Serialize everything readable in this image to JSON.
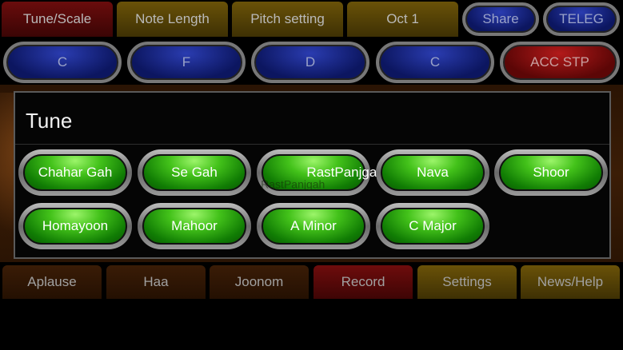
{
  "top_tabs": {
    "tune_scale": "Tune/Scale",
    "note_length": "Note Length",
    "pitch_setting": "Pitch setting",
    "octave": "Oct 1",
    "share": "Share",
    "teleg": "TELEG"
  },
  "key_buttons": [
    "C",
    "F",
    "D",
    "C"
  ],
  "acc_stop": "ACC STP",
  "dialog": {
    "title": "Tune",
    "options": [
      "Chahar Gah",
      "Se Gah",
      "RastPanjgah",
      "Nava",
      "Shoor",
      "Homayoon",
      "Mahoor",
      "A Minor",
      "C Major"
    ],
    "overlap_label": "RastPanjgah"
  },
  "bottom_tabs": [
    "Aplause",
    "Haa",
    "Joonom",
    "Record",
    "Settings",
    "News/Help"
  ],
  "colors": {
    "green_button": "#43c21a",
    "blue_button": "#0c1660",
    "red_button": "#8a0a0a",
    "background": "#000000"
  }
}
